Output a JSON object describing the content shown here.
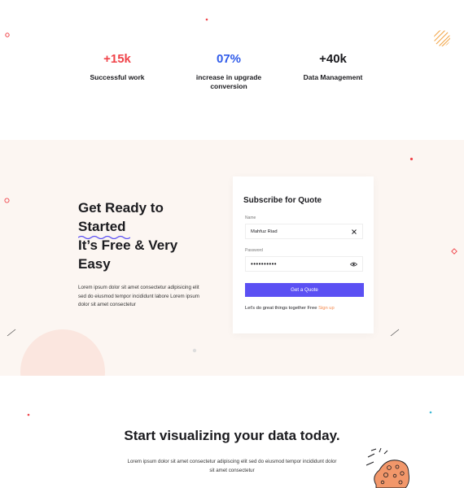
{
  "stats": [
    {
      "value": "+15k",
      "label": "Successful work",
      "color": "#f0444a"
    },
    {
      "value": "07%",
      "label": "increase in upgrade conversion",
      "color": "#2f5bea"
    },
    {
      "value": "+40k",
      "label": "Data Management",
      "color": "#1b1b1f"
    }
  ],
  "subscribe": {
    "headline_line1": "Get Ready to",
    "headline_underlined": "Started",
    "headline_line3": "It’s Free & Very",
    "headline_line4": "Easy",
    "paragraph": "Lorem ipsum dolor sit amet consectetur adipisicing elit sed do eiusmod tempor incididunt labore Lorem ipsum dolor sit amet consectetur",
    "card": {
      "title": "Subscribe for Quote",
      "name_label": "Name",
      "name_value": "Mahfuz Riad",
      "password_label": "Password",
      "password_value": "••••••••••",
      "button_label": "Get a Quote",
      "footer_text": "Let's do great things together Free ",
      "signup_link": "Sign up"
    }
  },
  "visualize": {
    "title": "Start visualizing your data today.",
    "paragraph": "Lorem ipsum dolor sit amet consectetur adipiscing elit sed do eiusmod tempor incididunt dolor sit amet consectetur"
  },
  "colors": {
    "accent_button": "#5b50f3",
    "link": "#f58a4e",
    "section_bg": "#fcf6f2"
  }
}
